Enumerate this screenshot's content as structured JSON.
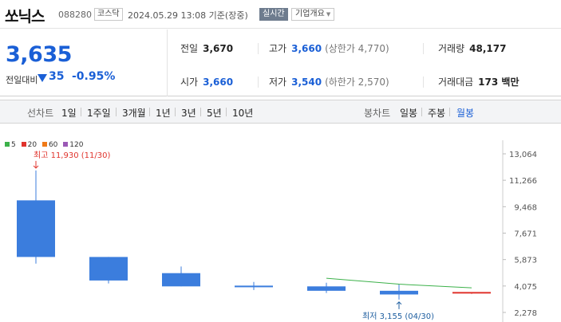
{
  "header": {
    "name": "쏘닉스",
    "code": "088280",
    "market": "코스닥",
    "datetime": "2024.05.29 13:08 기준(장중)",
    "realtime_badge": "실시간",
    "company_button": "기업개요"
  },
  "price": {
    "current": "3,635",
    "change_label": "전일대비",
    "change_value": "35",
    "change_pct": "-0.95%",
    "direction": "down",
    "color": "#1a5fd6"
  },
  "stats": {
    "prev_close": {
      "label": "전일",
      "value": "3,670"
    },
    "high": {
      "label": "고가",
      "value": "3,660",
      "sub": "(상한가 4,770)"
    },
    "volume": {
      "label": "거래량",
      "value": "48,177"
    },
    "open": {
      "label": "시가",
      "value": "3,660"
    },
    "low": {
      "label": "저가",
      "value": "3,540",
      "sub": "(하한가 2,570)"
    },
    "amount": {
      "label": "거래대금",
      "value": "173 백만"
    }
  },
  "chart_nav": {
    "line_label": "선차트",
    "line_ranges": [
      "1일",
      "1주일",
      "3개월",
      "1년",
      "3년",
      "5년",
      "10년"
    ],
    "candle_label": "봉차트",
    "candle_ranges": [
      "일봉",
      "주봉",
      "월봉"
    ],
    "active": "월봉"
  },
  "ma_legend": [
    {
      "label": "5",
      "color": "#3cb14a"
    },
    {
      "label": "20",
      "color": "#e0332c"
    },
    {
      "label": "60",
      "color": "#f07a18"
    },
    {
      "label": "120",
      "color": "#9b59b6"
    }
  ],
  "chart_data": {
    "type": "candlestick",
    "y_ticks": [
      "13,064",
      "11,266",
      "9,468",
      "7,671",
      "5,873",
      "4,075",
      "2,278"
    ],
    "ylim": [
      2278,
      13064
    ],
    "candles": [
      {
        "open": 9900,
        "close": 6050,
        "high": 11930,
        "low": 5600,
        "color": "#3b7ddd"
      },
      {
        "open": 6050,
        "close": 4450,
        "high": 6050,
        "low": 4250,
        "color": "#3b7ddd"
      },
      {
        "open": 4950,
        "close": 4050,
        "high": 5400,
        "low": 4050,
        "color": "#3b7ddd"
      },
      {
        "open": 4100,
        "close": 4000,
        "high": 4350,
        "low": 3800,
        "color": "#3b7ddd"
      },
      {
        "open": 4050,
        "close": 3750,
        "high": 4300,
        "low": 3600,
        "color": "#3b7ddd"
      },
      {
        "open": 3750,
        "close": 3500,
        "high": 4200,
        "low": 3155,
        "color": "#3b7ddd"
      },
      {
        "open": 3670,
        "close": 3635,
        "high": 3660,
        "low": 3540,
        "color": "#e0332c"
      }
    ],
    "ma5": [
      null,
      null,
      null,
      null,
      4600,
      4200,
      3950
    ],
    "high_annotation": {
      "text": "최고 11,930 (11/30)",
      "color": "#e0332c"
    },
    "low_annotation": {
      "text": "최저 3,155 (04/30)",
      "color": "#1f5fa0"
    }
  }
}
